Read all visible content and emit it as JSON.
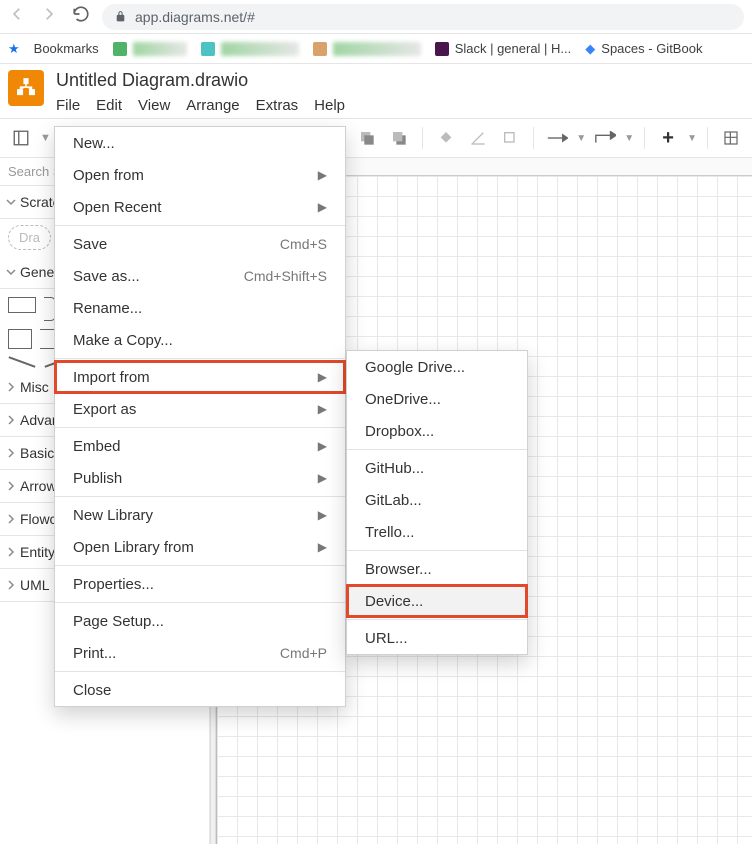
{
  "browser": {
    "url": "app.diagrams.net/#",
    "bookmarks_label": "Bookmarks",
    "bm_slack": "Slack | general | H...",
    "bm_spaces": "Spaces - GitBook"
  },
  "doc": {
    "title": "Untitled Diagram.drawio"
  },
  "menubar": {
    "file": "File",
    "edit": "Edit",
    "view": "View",
    "arrange": "Arrange",
    "extras": "Extras",
    "help": "Help"
  },
  "sidebar": {
    "search_placeholder": "Search S",
    "scratchpad": "Scratch",
    "drag_hint": "Dra",
    "general": "General",
    "sections": [
      "Misc",
      "Advance",
      "Basic",
      "Arrows",
      "Flowchart",
      "Entity Relation",
      "UML"
    ]
  },
  "file_menu": {
    "items": [
      {
        "label": "New...",
        "shortcut": "",
        "arrow": false
      },
      {
        "label": "Open from",
        "shortcut": "",
        "arrow": true
      },
      {
        "label": "Open Recent",
        "shortcut": "",
        "arrow": true
      },
      {
        "sep": true
      },
      {
        "label": "Save",
        "shortcut": "Cmd+S",
        "arrow": false
      },
      {
        "label": "Save as...",
        "shortcut": "Cmd+Shift+S",
        "arrow": false
      },
      {
        "label": "Rename...",
        "shortcut": "",
        "arrow": false
      },
      {
        "label": "Make a Copy...",
        "shortcut": "",
        "arrow": false
      },
      {
        "sep": true
      },
      {
        "label": "Import from",
        "shortcut": "",
        "arrow": true,
        "highlight": true
      },
      {
        "label": "Export as",
        "shortcut": "",
        "arrow": true
      },
      {
        "sep": true
      },
      {
        "label": "Embed",
        "shortcut": "",
        "arrow": true
      },
      {
        "label": "Publish",
        "shortcut": "",
        "arrow": true
      },
      {
        "sep": true
      },
      {
        "label": "New Library",
        "shortcut": "",
        "arrow": true
      },
      {
        "label": "Open Library from",
        "shortcut": "",
        "arrow": true
      },
      {
        "sep": true
      },
      {
        "label": "Properties...",
        "shortcut": "",
        "arrow": false
      },
      {
        "sep": true
      },
      {
        "label": "Page Setup...",
        "shortcut": "",
        "arrow": false
      },
      {
        "label": "Print...",
        "shortcut": "Cmd+P",
        "arrow": false
      },
      {
        "sep": true
      },
      {
        "label": "Close",
        "shortcut": "",
        "arrow": false
      }
    ]
  },
  "import_submenu": {
    "items": [
      {
        "label": "Google Drive..."
      },
      {
        "label": "OneDrive..."
      },
      {
        "label": "Dropbox..."
      },
      {
        "sep": true
      },
      {
        "label": "GitHub..."
      },
      {
        "label": "GitLab..."
      },
      {
        "label": "Trello..."
      },
      {
        "sep": true
      },
      {
        "label": "Browser..."
      },
      {
        "label": "Device...",
        "highlight": true,
        "hover": true
      },
      {
        "sep": true
      },
      {
        "label": "URL..."
      }
    ]
  }
}
